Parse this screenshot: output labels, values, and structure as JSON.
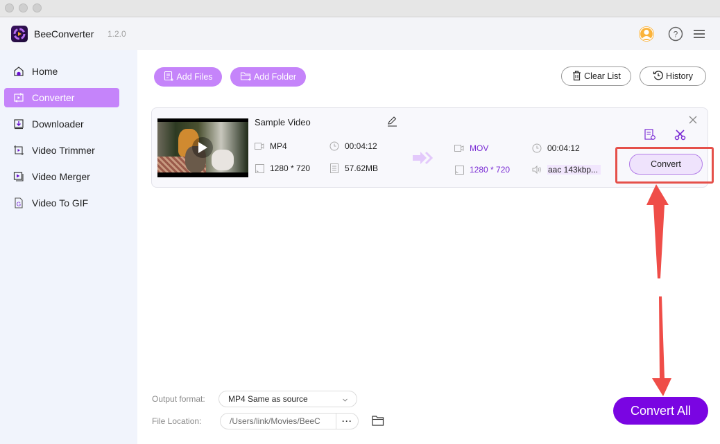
{
  "window": {
    "controls": [
      "close",
      "minimize",
      "maximize"
    ]
  },
  "header": {
    "app_name": "BeeConverter",
    "version": "1.2.0",
    "icons": [
      "account-icon",
      "help-icon",
      "menu-icon"
    ],
    "accent_color": "#c584fa"
  },
  "sidebar": {
    "items": [
      {
        "label": "Home",
        "icon": "home-icon",
        "active": false
      },
      {
        "label": "Converter",
        "icon": "converter-icon",
        "active": true
      },
      {
        "label": "Downloader",
        "icon": "downloader-icon",
        "active": false
      },
      {
        "label": "Video Trimmer",
        "icon": "trimmer-icon",
        "active": false
      },
      {
        "label": "Video Merger",
        "icon": "merger-icon",
        "active": false
      },
      {
        "label": "Video To GIF",
        "icon": "gif-icon",
        "active": false
      }
    ]
  },
  "toolbar": {
    "add_files": "Add Files",
    "add_folder": "Add Folder",
    "clear_list": "Clear List",
    "history": "History"
  },
  "file_item": {
    "title": "Sample Video",
    "source": {
      "format": "MP4",
      "duration": "00:04:12",
      "resolution": "1280 * 720",
      "size": "57.62MB"
    },
    "output": {
      "format": "MOV",
      "duration": "00:04:12",
      "resolution": "1280 * 720",
      "audio": "aac 143kbp..."
    },
    "convert_label": "Convert"
  },
  "footer": {
    "output_format_label": "Output format:",
    "output_format_value": "MP4 Same as source",
    "file_location_label": "File Location:",
    "file_location_value": "/Users/link/Movies/BeeC",
    "more_label": "···",
    "convert_all_label": "Convert All"
  },
  "annotation": {
    "color": "#e5504a",
    "note": "Red box highlights per-file Convert button; double-headed arrow links it to Convert All"
  }
}
